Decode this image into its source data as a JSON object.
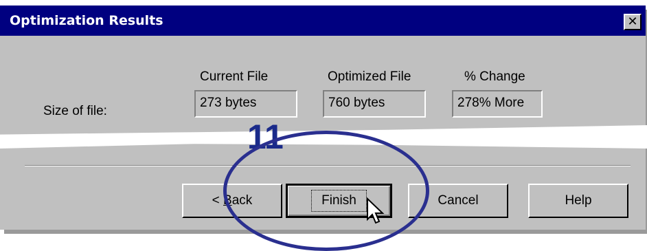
{
  "window": {
    "title": "Optimization Results",
    "close_glyph": "✕"
  },
  "table": {
    "row_label": "Size of file:",
    "columns": [
      "Current File",
      "Optimized File",
      "% Change"
    ],
    "values": [
      "273 bytes",
      "760 bytes",
      "278% More"
    ]
  },
  "annotation": {
    "step_number": "11",
    "color": "#2a2f8f"
  },
  "buttons": {
    "back": {
      "prefix": "< ",
      "mnemonic": "B",
      "rest": "ack"
    },
    "finish": "Finish",
    "cancel": "Cancel",
    "help": "Help"
  },
  "colors": {
    "titlebar": "#000080",
    "dialog_bg": "#c0c0c0"
  },
  "icons": {
    "close": "close-icon",
    "cursor": "arrow-cursor-icon"
  }
}
